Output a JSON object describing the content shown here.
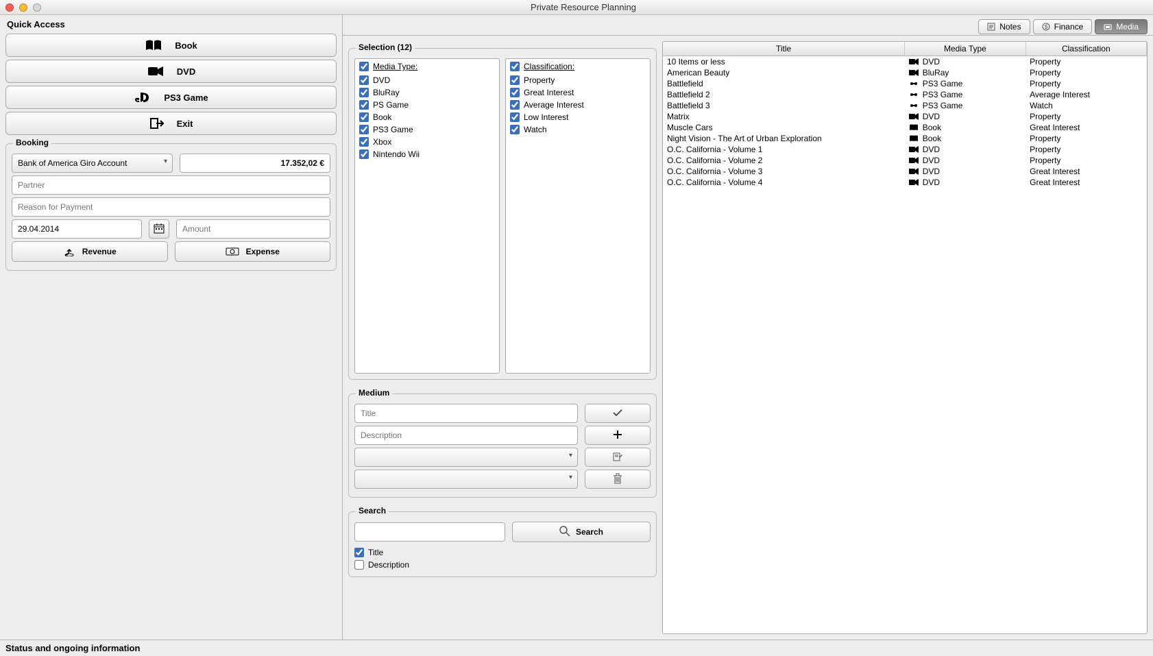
{
  "window": {
    "title": "Private Resource Planning"
  },
  "quick_access": {
    "heading": "Quick Access",
    "buttons": {
      "book": "Book",
      "dvd": "DVD",
      "ps3": "PS3 Game",
      "exit": "Exit"
    }
  },
  "booking": {
    "heading": "Booking",
    "account_selected": "Bank of America Giro Account",
    "balance": "17.352,02 €",
    "partner_placeholder": "Partner",
    "reason_placeholder": "Reason for Payment",
    "date": "29.04.2014",
    "amount_placeholder": "Amount",
    "revenue": "Revenue",
    "expense": "Expense"
  },
  "tabs": {
    "notes": "Notes",
    "finance": "Finance",
    "media": "Media"
  },
  "selection": {
    "heading": "Selection (12)",
    "media_type_label": "Media Type:",
    "classification_label": "Classification:",
    "media_types": [
      "DVD",
      "BluRay",
      "PS Game",
      "Book",
      "PS3 Game",
      "Xbox",
      "Nintendo Wii"
    ],
    "classifications": [
      "Property",
      "Great Interest",
      "Average Interest",
      "Low Interest",
      "Watch"
    ]
  },
  "medium": {
    "heading": "Medium",
    "title_placeholder": "Title",
    "desc_placeholder": "Description"
  },
  "search": {
    "heading": "Search",
    "button": "Search",
    "title_cb": "Title",
    "desc_cb": "Description"
  },
  "table": {
    "columns": {
      "title": "Title",
      "media_type": "Media Type",
      "classification": "Classification"
    },
    "rows": [
      {
        "title": "10 Items or less",
        "media_type": "DVD",
        "classification": "Property"
      },
      {
        "title": "American Beauty",
        "media_type": "BluRay",
        "classification": "Property"
      },
      {
        "title": "Battlefield",
        "media_type": "PS3 Game",
        "classification": "Property"
      },
      {
        "title": "Battlefield 2",
        "media_type": "PS3 Game",
        "classification": "Average Interest"
      },
      {
        "title": "Battlefield 3",
        "media_type": "PS3 Game",
        "classification": "Watch"
      },
      {
        "title": "Matrix",
        "media_type": "DVD",
        "classification": "Property"
      },
      {
        "title": "Muscle Cars",
        "media_type": "Book",
        "classification": "Great Interest"
      },
      {
        "title": "Night Vision - The Art of Urban Exploration",
        "media_type": "Book",
        "classification": "Property"
      },
      {
        "title": "O.C. California - Volume 1",
        "media_type": "DVD",
        "classification": "Property"
      },
      {
        "title": "O.C. California - Volume 2",
        "media_type": "DVD",
        "classification": "Property"
      },
      {
        "title": "O.C. California - Volume 3",
        "media_type": "DVD",
        "classification": "Great Interest"
      },
      {
        "title": "O.C. California - Volume 4",
        "media_type": "DVD",
        "classification": "Great Interest"
      }
    ]
  },
  "status": "Status and ongoing information"
}
